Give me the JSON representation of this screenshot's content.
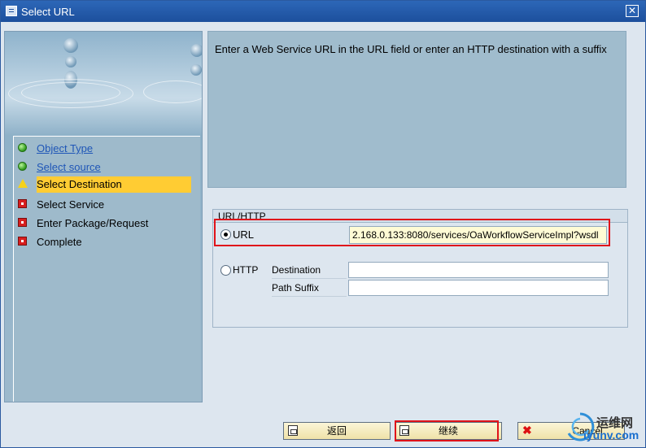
{
  "window": {
    "title": "Select URL",
    "close_icon": "close-icon"
  },
  "wizard": {
    "steps": [
      {
        "label": "Object Type",
        "status": "done",
        "icon": "green-dot-icon",
        "link": true
      },
      {
        "label": "Select source",
        "status": "done",
        "icon": "green-dot-icon",
        "link": true
      },
      {
        "label": "Select Destination",
        "status": "current",
        "icon": "warning-triangle-icon",
        "link": false
      },
      {
        "label": "Select Service",
        "status": "pending",
        "icon": "red-square-icon",
        "link": false
      },
      {
        "label": "Enter Package/Request",
        "status": "pending",
        "icon": "red-square-icon",
        "link": false
      },
      {
        "label": "Complete",
        "status": "pending",
        "icon": "red-square-icon",
        "link": false
      }
    ]
  },
  "info": {
    "text": "Enter a Web Service URL in the URL field or enter an HTTP destination with a suffix"
  },
  "group": {
    "title": "URL/HTTP",
    "url_option": {
      "label": "URL",
      "selected": true,
      "value": "2.168.0.133:8080/services/OaWorkflowServiceImpl?wsdl"
    },
    "http_option": {
      "label": "HTTP",
      "selected": false
    },
    "destination": {
      "label": "Destination",
      "value": ""
    },
    "path_suffix": {
      "label": "Path Suffix",
      "value": ""
    }
  },
  "buttons": {
    "back": {
      "label": "返回",
      "icon": "back-doc-icon"
    },
    "continue": {
      "label": "继续",
      "icon": "continue-doc-icon"
    },
    "cancel": {
      "label": "Cancel",
      "icon": "cancel-x-icon"
    }
  },
  "watermark": {
    "cn": "运维网",
    "en": "iyunv.com"
  },
  "colors": {
    "highlight": "#e0131a",
    "active_step": "#ffcc33",
    "link": "#1f56b7",
    "titlebar": "#1c4f9c"
  }
}
